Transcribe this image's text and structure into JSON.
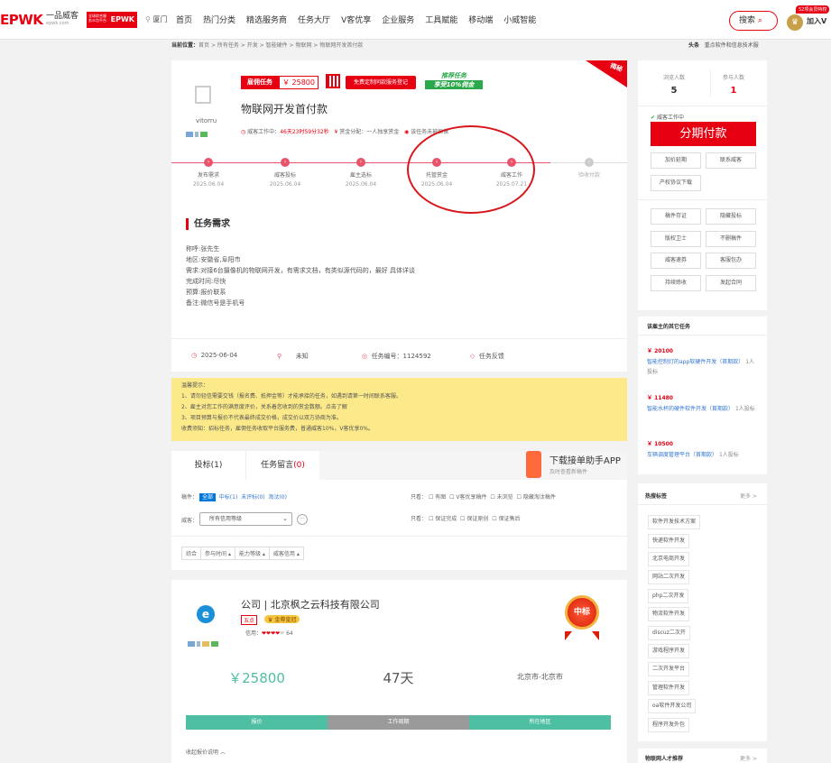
{
  "header": {
    "logo": "EPWK",
    "logo_sub_a": "一品威客",
    "logo_sub_b": "epwk.com",
    "logo_badge": "EPWK",
    "logo_badge_text": "全球综合服务众包平台",
    "city": "厦门",
    "nav": [
      "首页",
      "热门分类",
      "精选服务商",
      "任务大厅",
      "V客优享",
      "企业服务",
      "工具赋能",
      "移动端",
      "小威智能"
    ],
    "search_label": "搜索",
    "vip_tag": "52项会员特权",
    "vip_label": "加入V"
  },
  "breadcrumb": {
    "prefix": "当前位置：",
    "items": [
      "首页",
      "所有任务",
      "开发",
      "智能硬件",
      "物联网",
      "物联网开发首付款"
    ]
  },
  "notice": {
    "label": "头条",
    "text": "重点软件和信息技术服"
  },
  "task": {
    "avatar_name": "vitorru",
    "mode_label": "雇佣任务",
    "price": "￥ 25800",
    "free_btn": "免费定制同款服务登记",
    "promo_a": "推荐任务",
    "promo_b": "享受10%佣金",
    "corner": "揭秘",
    "title": "物联网开发首付款",
    "status": "威客工作中：",
    "countdown": "46天23时59分32秒",
    "reward": "赏金分配：一人独享赏金",
    "guarantee": "该任务未被担保",
    "steps": [
      {
        "label": "发布需求",
        "date": "2025.06.04"
      },
      {
        "label": "威客投标",
        "date": "2025.06.04"
      },
      {
        "label": "雇主选标",
        "date": "2025.06.04"
      },
      {
        "label": "托管赏金",
        "date": "2025.06.04"
      },
      {
        "label": "威客工作",
        "date": "2025.07.21"
      },
      {
        "label": "验收付款",
        "date": ""
      }
    ],
    "req_title": "任务需求",
    "req_lines": [
      "称呼:张先生",
      "地区:安徽省,阜阳市",
      "需求:对接6台摄像机的物联网开发，有需求文档，有类似源代码的，最好 具体详谈",
      "完成时间:尽快",
      "预算:报价联系",
      "备注:微信号是手机号"
    ],
    "meta_date": "2025-06-04",
    "meta_loc": "未知",
    "meta_no": "任务编号：1124592",
    "meta_feedback": "任务反馈"
  },
  "warn": {
    "title": "温馨提示：",
    "lines": [
      "1、请勿轻信需要交钱（报名费、抵押金等）才能承接的任务，如遇到请第一时间联系客服。",
      "2、雇主对您工作的满意度评价，关系着您收到的赏金数额。点击了解",
      "3、项目预算与报价不代表最终成交价格，成交价以双方协商为准。"
    ],
    "fee": "收费须知：招标任务，雇佣任务收取平台服务费，普通威客10%，V客优享0%。"
  },
  "tabs": {
    "bid": "投标(1)",
    "msg": "任务留言",
    "msg_count": "(0)",
    "app_title": "下载接单助手APP",
    "app_sub": "及时查看新稿件"
  },
  "filters": {
    "manu_label": "稿件：",
    "manu": [
      "全部",
      "中标(1)",
      "未评标(0)",
      "淘汰(0)"
    ],
    "view_label": "只看：",
    "view": [
      "有图",
      "V客优享稿件",
      "未浏览",
      "隐藏淘汰稿件"
    ],
    "wk_label": "威客：",
    "wk_select": "所有信用等级",
    "view2": [
      "保证完成",
      "保证原创",
      "保证售后"
    ],
    "sorts": [
      "综合",
      "参与时间",
      "能力等级",
      "威客信用"
    ]
  },
  "bidder": {
    "name": "公司 | 北京枫之云科技有限公司",
    "level": "五点",
    "tag": "金尊皇冠",
    "credit_label": "信用：",
    "credit": "64",
    "medal": "中标",
    "price": "￥25800",
    "days": "47天",
    "loc": "北京市-北京市",
    "lbl_price": "报价",
    "lbl_days": "工作周期",
    "lbl_loc": "所在地区",
    "collapse": "收起报价说明"
  },
  "right": {
    "views_label": "浏览人数",
    "views": "5",
    "joins_label": "参与人数",
    "joins": "1",
    "working": "威客工作中",
    "pay_btn": "分期付款",
    "b1": [
      "加价延期",
      "联系威客"
    ],
    "b2": "产权协议下载",
    "grid": [
      "稿件存证",
      "隐藏投标",
      "版权卫士",
      "不删稿件",
      "威客速券",
      "客服包办",
      "持续赊收",
      "发起合同"
    ],
    "other_title": "该雇主的其它任务",
    "others": [
      {
        "price": "￥ 20100",
        "name": "智能控制灯的app软硬件开发（首期款）",
        "n": "1人投标"
      },
      {
        "price": "￥ 11480",
        "name": "智能水杯的硬件软件开发（首期款）",
        "n": "1人投标"
      },
      {
        "price": "￥ 10500",
        "name": "车辆调度管理平台（首期款）",
        "n": "1人投标"
      }
    ],
    "hot_title": "热搜标签",
    "more": "更多 >",
    "hot_tags": [
      "软件开发技术方案",
      "快递软件开发",
      "北京电商开发",
      "网站二次开发",
      "php二次开发",
      "物流软件开发",
      "discuz二次开",
      "游戏程序开发",
      "二次开发平台",
      "管理软件开发",
      "oa软件开发公司",
      "程序开发外包"
    ],
    "talent_title": "物联网人才推荐"
  },
  "colors": {
    "brand": "#e60012",
    "pink": "#e9546b",
    "teal": "#4fbfa3",
    "yellow": "#fbe98a"
  }
}
